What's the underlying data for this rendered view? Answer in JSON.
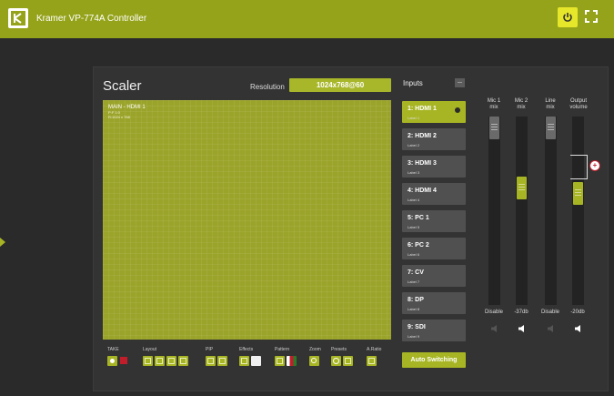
{
  "header": {
    "title": "Kramer VP-774A Controller"
  },
  "scaler": {
    "title": "Scaler",
    "resolution_label": "Resolution",
    "resolution_value": "1024x768@60",
    "preview": {
      "line1": "MAIN - HDMI 1",
      "line2": "P:F 1:0",
      "line3": "R:1024 x 768"
    }
  },
  "toolbar": {
    "take_label": "TAKE",
    "layout_label": "Layout",
    "pip_label": "PIP",
    "effects_label": "Effects",
    "pattern_label": "Pattern",
    "zoom_label": "Zoom",
    "presets_label": "Presets",
    "aratio_label": "A.Ratio"
  },
  "inputs": {
    "title": "Inputs",
    "items": [
      {
        "label": "1: HDMI 1",
        "sub": "Label 1"
      },
      {
        "label": "2: HDMI 2",
        "sub": "Label 2"
      },
      {
        "label": "3: HDMI 3",
        "sub": "Label 3"
      },
      {
        "label": "4: HDMI 4",
        "sub": "Label 4"
      },
      {
        "label": "5: PC 1",
        "sub": "Label 5"
      },
      {
        "label": "6: PC 2",
        "sub": "Label 6"
      },
      {
        "label": "7: CV",
        "sub": "Label 7"
      },
      {
        "label": "8: DP",
        "sub": "Label 8"
      },
      {
        "label": "9: SDI",
        "sub": "Label 9"
      }
    ],
    "active_index": 0,
    "auto_switching": "Auto Switching"
  },
  "audio": {
    "mic1": {
      "head1": "Mic 1",
      "head2": "mix",
      "value": "Disable"
    },
    "mic2": {
      "head1": "Mic 2",
      "head2": "mix",
      "value": "-37db"
    },
    "line": {
      "head1": "Line",
      "head2": "mix",
      "value": "Disable"
    },
    "output": {
      "head1": "Output",
      "head2": "volume",
      "value": "-20db"
    }
  },
  "colors": {
    "accent": "#a7b524",
    "topbar": "#95a31a",
    "background": "#2a2a2a",
    "panel": "#333333"
  },
  "icons": [
    "kramer-logo-icon",
    "power-icon",
    "fullscreen-icon",
    "speaker-icon",
    "link-plus-icon"
  ]
}
